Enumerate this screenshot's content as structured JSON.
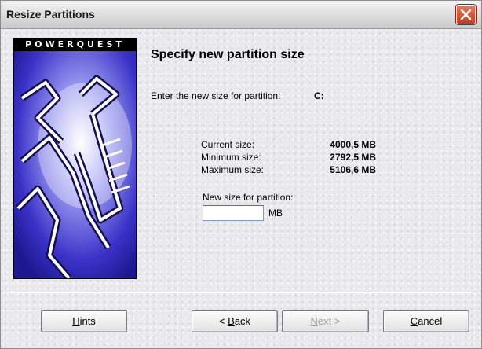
{
  "window": {
    "title": "Resize Partitions"
  },
  "banner": {
    "logo_text": "POWERQUEST"
  },
  "content": {
    "heading": "Specify new partition size",
    "prompt": "Enter the new size for partition:",
    "drive": "C:",
    "sizes": [
      {
        "label": "Current size:",
        "value": "4000,5 MB"
      },
      {
        "label": "Minimum size:",
        "value": "2792,5 MB"
      },
      {
        "label": "Maximum size:",
        "value": "5106,6 MB"
      }
    ],
    "new_size_label": "New size for partition:",
    "new_size_value": "",
    "new_size_unit": "MB"
  },
  "buttons": {
    "hints": {
      "pre": "",
      "mnemonic": "H",
      "post": "ints"
    },
    "back": {
      "pre": "< ",
      "mnemonic": "B",
      "post": "ack"
    },
    "next": {
      "pre": "",
      "mnemonic": "N",
      "post": "ext >",
      "enabled": false
    },
    "cancel": {
      "pre": "",
      "mnemonic": "C",
      "post": "ancel"
    }
  }
}
